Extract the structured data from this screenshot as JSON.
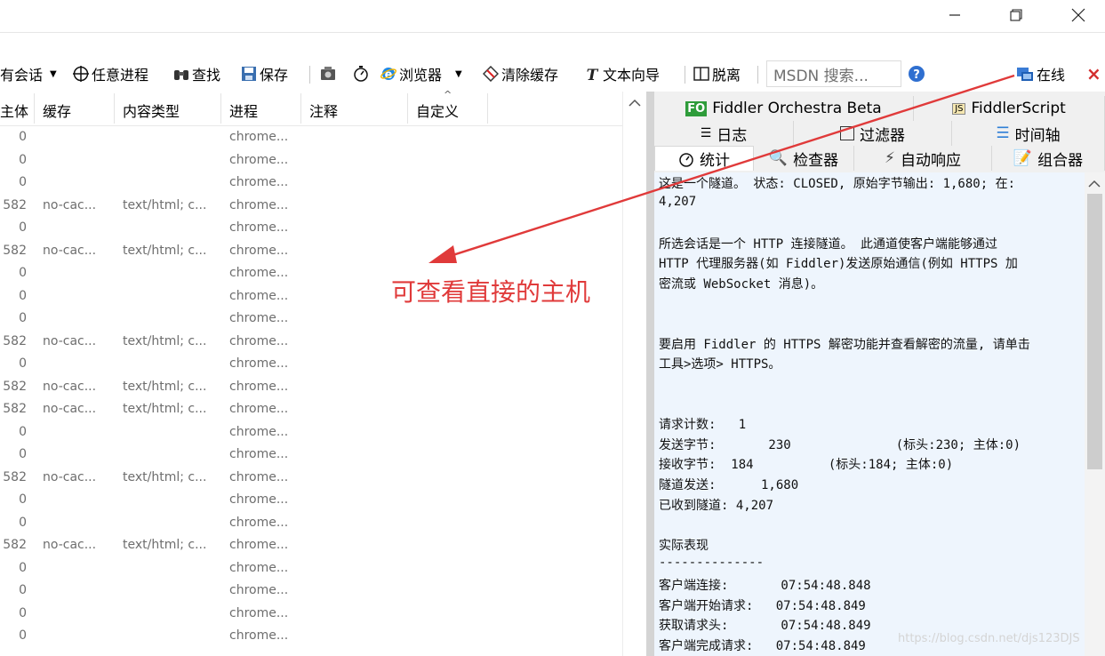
{
  "window": {
    "min_icon": "minimize-icon",
    "max_icon": "maximize-icon",
    "close_icon": "close-icon"
  },
  "toolbar": {
    "sessions_label": "有会话",
    "any_process_label": "任意进程",
    "find_label": "查找",
    "save_label": "保存",
    "browser_label": "浏览器",
    "clear_cache_label": "清除缓存",
    "text_wizard_label": "文本向导",
    "tearoff_label": "脱离",
    "msdn_placeholder": "MSDN 搜索...",
    "online_label": "在线",
    "close_x": "×"
  },
  "columns": [
    "主体",
    "缓存",
    "内容类型",
    "进程",
    "注释",
    "自定义"
  ],
  "rows": [
    {
      "body": "0",
      "cache": "",
      "ctype": "",
      "proc": "chrome..."
    },
    {
      "body": "0",
      "cache": "",
      "ctype": "",
      "proc": "chrome..."
    },
    {
      "body": "0",
      "cache": "",
      "ctype": "",
      "proc": "chrome..."
    },
    {
      "body": "582",
      "cache": "no-cac...",
      "ctype": "text/html; c...",
      "proc": "chrome..."
    },
    {
      "body": "0",
      "cache": "",
      "ctype": "",
      "proc": "chrome..."
    },
    {
      "body": "582",
      "cache": "no-cac...",
      "ctype": "text/html; c...",
      "proc": "chrome..."
    },
    {
      "body": "0",
      "cache": "",
      "ctype": "",
      "proc": "chrome..."
    },
    {
      "body": "0",
      "cache": "",
      "ctype": "",
      "proc": "chrome..."
    },
    {
      "body": "0",
      "cache": "",
      "ctype": "",
      "proc": "chrome..."
    },
    {
      "body": "582",
      "cache": "no-cac...",
      "ctype": "text/html; c...",
      "proc": "chrome..."
    },
    {
      "body": "0",
      "cache": "",
      "ctype": "",
      "proc": "chrome..."
    },
    {
      "body": "582",
      "cache": "no-cac...",
      "ctype": "text/html; c...",
      "proc": "chrome..."
    },
    {
      "body": "582",
      "cache": "no-cac...",
      "ctype": "text/html; c...",
      "proc": "chrome..."
    },
    {
      "body": "0",
      "cache": "",
      "ctype": "",
      "proc": "chrome..."
    },
    {
      "body": "0",
      "cache": "",
      "ctype": "",
      "proc": "chrome..."
    },
    {
      "body": "582",
      "cache": "no-cac...",
      "ctype": "text/html; c...",
      "proc": "chrome..."
    },
    {
      "body": "0",
      "cache": "",
      "ctype": "",
      "proc": "chrome..."
    },
    {
      "body": "0",
      "cache": "",
      "ctype": "",
      "proc": "chrome..."
    },
    {
      "body": "582",
      "cache": "no-cac...",
      "ctype": "text/html; c...",
      "proc": "chrome..."
    },
    {
      "body": "0",
      "cache": "",
      "ctype": "",
      "proc": "chrome..."
    },
    {
      "body": "0",
      "cache": "",
      "ctype": "",
      "proc": "chrome..."
    },
    {
      "body": "0",
      "cache": "",
      "ctype": "",
      "proc": "chrome..."
    },
    {
      "body": "0",
      "cache": "",
      "ctype": "",
      "proc": "chrome..."
    }
  ],
  "tabs": {
    "orchestra": "Fiddler Orchestra Beta",
    "orchestra_badge": "FO",
    "script": "FiddlerScript",
    "script_badge": "JS",
    "log": "日志",
    "filters": "过滤器",
    "timeline": "时间轴",
    "stats": "统计",
    "inspectors": "检查器",
    "autoresponder": "自动响应",
    "composer": "组合器"
  },
  "stats_lines": [
    "这是一个隧道。 状态: CLOSED, 原始字节输出: 1,680; 在:",
    "4,207",
    "",
    "所选会话是一个 HTTP 连接隧道。 此通道使客户端能够通过",
    "HTTP 代理服务器(如 Fiddler)发送原始通信(例如 HTTPS 加",
    "密流或 WebSocket 消息)。",
    "",
    "",
    "要启用 Fiddler 的 HTTPS 解密功能并查看解密的流量, 请单击",
    "工具>选项> HTTPS。",
    "",
    "",
    "请求计数:   1",
    "发送字节:       230              (标头:230; 主体:0)",
    "接收字节:  184          (标头:184; 主体:0)",
    "隧道发送:      1,680",
    "已收到隧道: 4,207",
    "",
    "实际表现",
    "--------------",
    "客户端连接:       07:54:48.848",
    "客户端开始请求:   07:54:48.849",
    "获取请求头:       07:54:48.849",
    "客户端完成请求:   07:54:48.849"
  ],
  "annotation": "可查看直接的主机",
  "watermark": "https://blog.csdn.net/djs123DJS",
  "colors": {
    "annotation": "#e03a3a",
    "content_bg": "#eef5fd"
  }
}
